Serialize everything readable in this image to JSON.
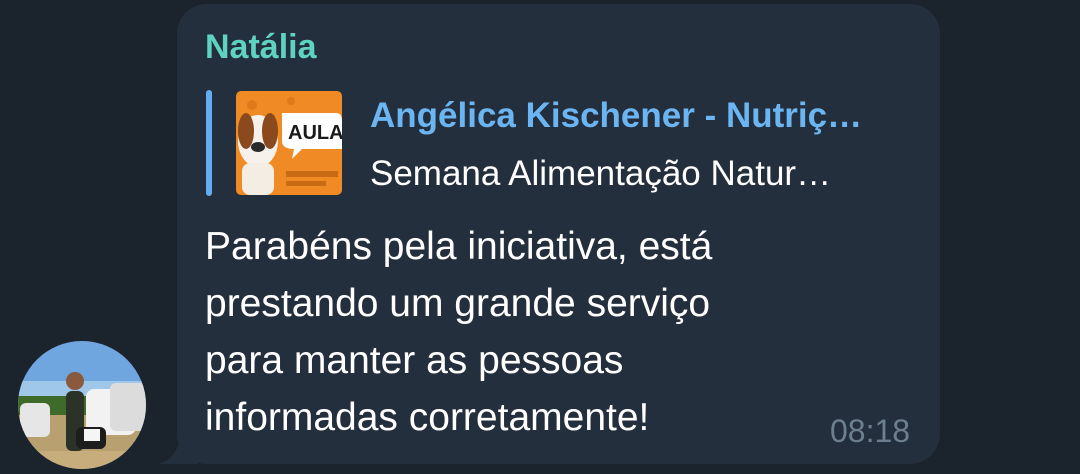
{
  "message": {
    "sender_name": "Natália",
    "reply": {
      "title": "Angélica Kischener - Nutriç…",
      "subtitle": "Semana Alimentação Natur…",
      "thumbnail_text": "AULA"
    },
    "text": "Parabéns pela iniciativa, está\nprestando um grande serviço\npara manter as pessoas\ninformadas corretamente!",
    "time": "08:18"
  },
  "colors": {
    "background": "#1b232d",
    "bubble": "#242f3d",
    "sender": "#5ed3c1",
    "reply_accent": "#62aef0",
    "reply_title": "#6bb5f2",
    "text": "#ffffff",
    "time": "#6d7f8f"
  },
  "icons": {
    "avatar": "user-avatar-photo",
    "reply_thumbnail": "dog-thumbnail-image"
  }
}
